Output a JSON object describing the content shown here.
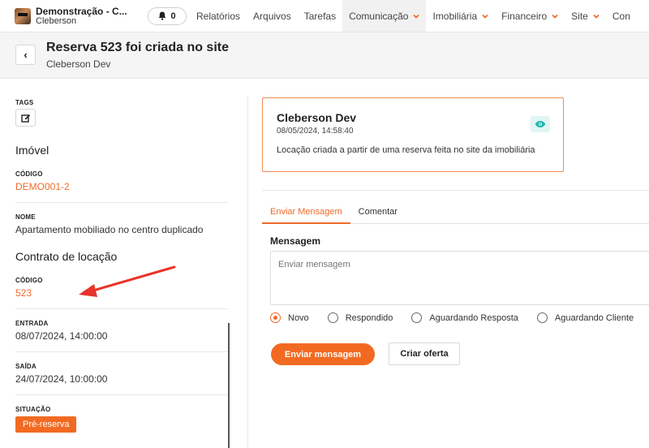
{
  "topbar": {
    "brand_title": "Demonstração - C...",
    "brand_subtitle": "Cleberson",
    "notifications_count": "0",
    "nav": [
      {
        "label": "Relatórios"
      },
      {
        "label": "Arquivos"
      },
      {
        "label": "Tarefas"
      },
      {
        "label": "Comunicação"
      },
      {
        "label": "Imobiliária"
      },
      {
        "label": "Financeiro"
      },
      {
        "label": "Site"
      },
      {
        "label": "Con"
      }
    ]
  },
  "header": {
    "back_label": "‹",
    "title": "Reserva 523 foi criada no site",
    "subtitle": "Cleberson Dev"
  },
  "left": {
    "tags_label": "TAGS",
    "imovel_title": "Imóvel",
    "codigo_label": "CÓDIGO",
    "codigo_value": "DEMO001-2",
    "nome_label": "NOME",
    "nome_value": "Apartamento mobiliado no centro duplicado",
    "contrato_title": "Contrato de locação",
    "contrato_codigo_label": "CÓDIGO",
    "contrato_codigo_value": "523",
    "entrada_label": "ENTRADA",
    "entrada_value": "08/07/2024, 14:00:00",
    "saida_label": "SAÍDA",
    "saida_value": "24/07/2024, 10:00:00",
    "situacao_label": "SITUAÇÃO",
    "situacao_value": "Pré-reserva"
  },
  "card": {
    "name": "Cleberson Dev",
    "date": "08/05/2024, 14:58:40",
    "message": "Locação criada a partir de uma reserva feita no site da imobiliária"
  },
  "tabs": [
    {
      "label": "Enviar Mensagem"
    },
    {
      "label": "Comentar"
    }
  ],
  "form": {
    "message_label": "Mensagem",
    "message_placeholder": "Enviar mensagem",
    "statuses": [
      {
        "label": "Novo"
      },
      {
        "label": "Respondido"
      },
      {
        "label": "Aguardando Resposta"
      },
      {
        "label": "Aguardando Cliente"
      }
    ],
    "send_label": "Enviar mensagem",
    "offer_label": "Criar oferta"
  },
  "colors": {
    "accent": "#f26a22",
    "eye_bg": "#dff6f5",
    "eye_icon": "#1fb5ad",
    "arrow": "#e8332a"
  }
}
